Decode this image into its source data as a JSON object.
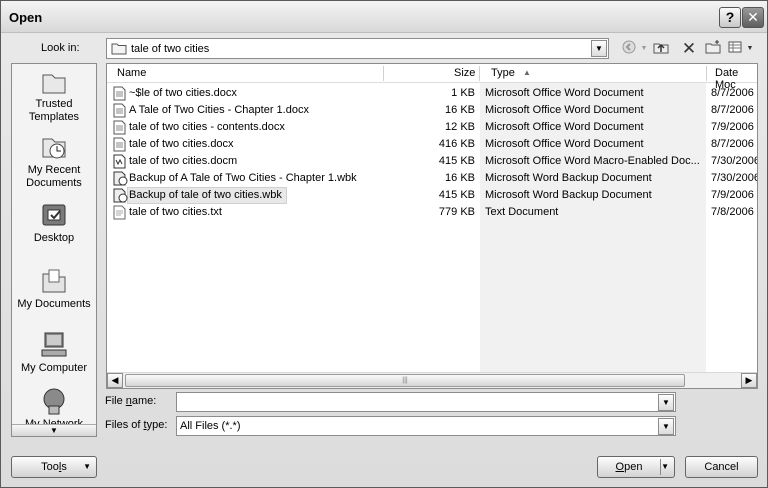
{
  "window": {
    "title": "Open",
    "help_glyph": "?",
    "close_glyph": "✕"
  },
  "lookin": {
    "label": "Look in:",
    "value": "tale of two cities"
  },
  "places": [
    {
      "label1": "Trusted",
      "label2": "Templates"
    },
    {
      "label1": "My Recent",
      "label2": "Documents"
    },
    {
      "label1": "Desktop",
      "label2": ""
    },
    {
      "label1": "My Documents",
      "label2": ""
    },
    {
      "label1": "My Computer",
      "label2": ""
    },
    {
      "label1": "My Network",
      "label2": ""
    }
  ],
  "columns": {
    "name": "Name",
    "size": "Size",
    "type": "Type",
    "date": "Date Moc"
  },
  "files": [
    {
      "name": "~$le of two cities.docx",
      "size": "1 KB",
      "type": "Microsoft Office Word Document",
      "date": "8/7/2006",
      "icon": "word-doc-icon"
    },
    {
      "name": "A Tale of Two Cities - Chapter 1.docx",
      "size": "16 KB",
      "type": "Microsoft Office Word Document",
      "date": "8/7/2006",
      "icon": "word-doc-icon"
    },
    {
      "name": "tale of two cities - contents.docx",
      "size": "12 KB",
      "type": "Microsoft Office Word Document",
      "date": "7/9/2006",
      "icon": "word-doc-icon"
    },
    {
      "name": "tale of two cities.docx",
      "size": "416 KB",
      "type": "Microsoft Office Word Document",
      "date": "8/7/2006",
      "icon": "word-doc-icon"
    },
    {
      "name": "tale of two cities.docm",
      "size": "415 KB",
      "type": "Microsoft Office Word Macro-Enabled Doc...",
      "date": "7/30/2006",
      "icon": "word-macro-doc-icon"
    },
    {
      "name": "Backup of A Tale of Two Cities - Chapter 1.wbk",
      "size": "16 KB",
      "type": "Microsoft Word Backup Document",
      "date": "7/30/2006",
      "icon": "word-backup-icon"
    },
    {
      "name": "Backup of tale of two cities.wbk",
      "size": "415 KB",
      "type": "Microsoft Word Backup Document",
      "date": "7/9/2006",
      "icon": "word-backup-icon"
    },
    {
      "name": "tale of two cities.txt",
      "size": "779 KB",
      "type": "Text Document",
      "date": "7/8/2006",
      "icon": "text-file-icon"
    }
  ],
  "filename": {
    "label_pre": "File ",
    "label_u": "n",
    "label_post": "ame:",
    "value": ""
  },
  "filetype": {
    "label_pre": "Files of ",
    "label_u": "t",
    "label_post": "ype:",
    "value": "All Files (*.*)"
  },
  "buttons": {
    "tools_pre": "Too",
    "tools_u": "l",
    "tools_post": "s",
    "open_u": "O",
    "open_post": "pen",
    "cancel": "Cancel"
  }
}
